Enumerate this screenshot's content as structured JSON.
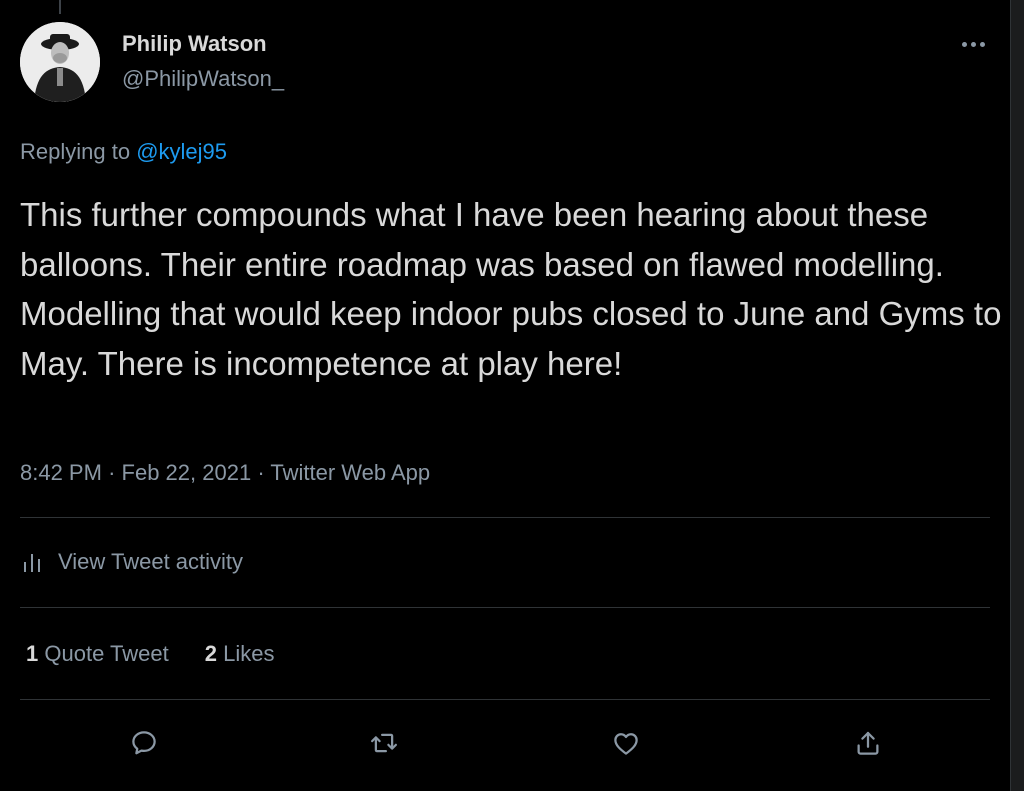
{
  "author": {
    "name": "Philip Watson",
    "handle": "@PhilipWatson_"
  },
  "reply": {
    "prefix": "Replying to",
    "handle": "@kylej95"
  },
  "tweet": {
    "text": "This further compounds what I have been hearing about these balloons. Their entire roadmap was based on flawed modelling. Modelling that would keep indoor pubs closed to June and Gyms to May. There is incompetence at play here!",
    "time": "8:42 PM",
    "separator": "·",
    "date": "Feb 22, 2021",
    "source": "Twitter Web App"
  },
  "activity": {
    "label": "View Tweet activity",
    "icon": "bar-chart-icon"
  },
  "stats": {
    "quote_count": "1",
    "quote_label": "Quote Tweet",
    "like_count": "2",
    "like_label": "Likes"
  },
  "actions": {
    "icons": [
      "reply-icon",
      "retweet-icon",
      "like-icon",
      "share-icon"
    ]
  },
  "colors": {
    "background": "#000000",
    "text": "#d9d9d9",
    "muted": "#8b98a5",
    "accent": "#1d9bf0",
    "divider": "#2f3336"
  }
}
